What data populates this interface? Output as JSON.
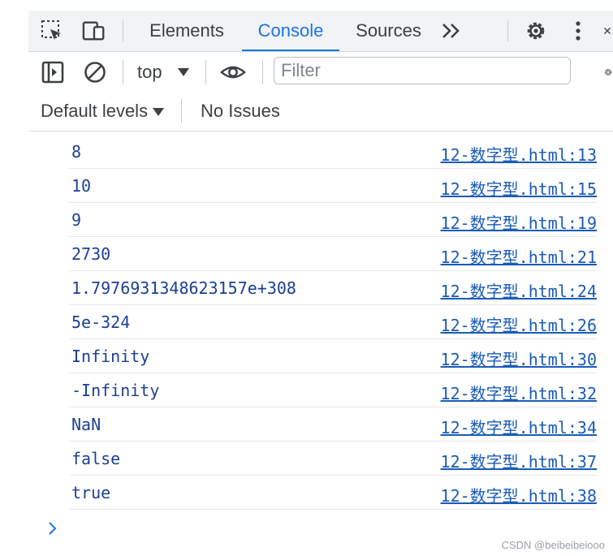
{
  "tabs": {
    "elements": "Elements",
    "console": "Console",
    "sources": "Sources",
    "more": "»"
  },
  "toolbar": {
    "context": "top",
    "filter_placeholder": "Filter"
  },
  "levels": {
    "label": "Default levels",
    "issues": "No Issues"
  },
  "messages": [
    {
      "text": "8",
      "source": "12-数字型.html:13"
    },
    {
      "text": "10",
      "source": "12-数字型.html:15"
    },
    {
      "text": "9",
      "source": "12-数字型.html:19"
    },
    {
      "text": "2730",
      "source": "12-数字型.html:21"
    },
    {
      "text": "1.7976931348623157e+308",
      "source": "12-数字型.html:24"
    },
    {
      "text": "5e-324",
      "source": "12-数字型.html:26"
    },
    {
      "text": "Infinity",
      "source": "12-数字型.html:30"
    },
    {
      "text": "-Infinity",
      "source": "12-数字型.html:32"
    },
    {
      "text": "NaN",
      "source": "12-数字型.html:34"
    },
    {
      "text": "false",
      "source": "12-数字型.html:37"
    },
    {
      "text": "true",
      "source": "12-数字型.html:38"
    }
  ],
  "watermark": "CSDN @beibeibeiooo",
  "colors": {
    "accent": "#1a73e8",
    "message_text": "#1c3f95",
    "link": "#1a5bb8"
  },
  "icons": [
    "inspect-icon",
    "device-toggle-icon",
    "more-tabs-icon",
    "gear-icon",
    "kebab-menu-icon",
    "close-icon",
    "sidebar-toggle-icon",
    "clear-console-icon",
    "dropdown-arrow-icon",
    "eye-icon",
    "settings-icon",
    "prompt-chevron-icon"
  ]
}
